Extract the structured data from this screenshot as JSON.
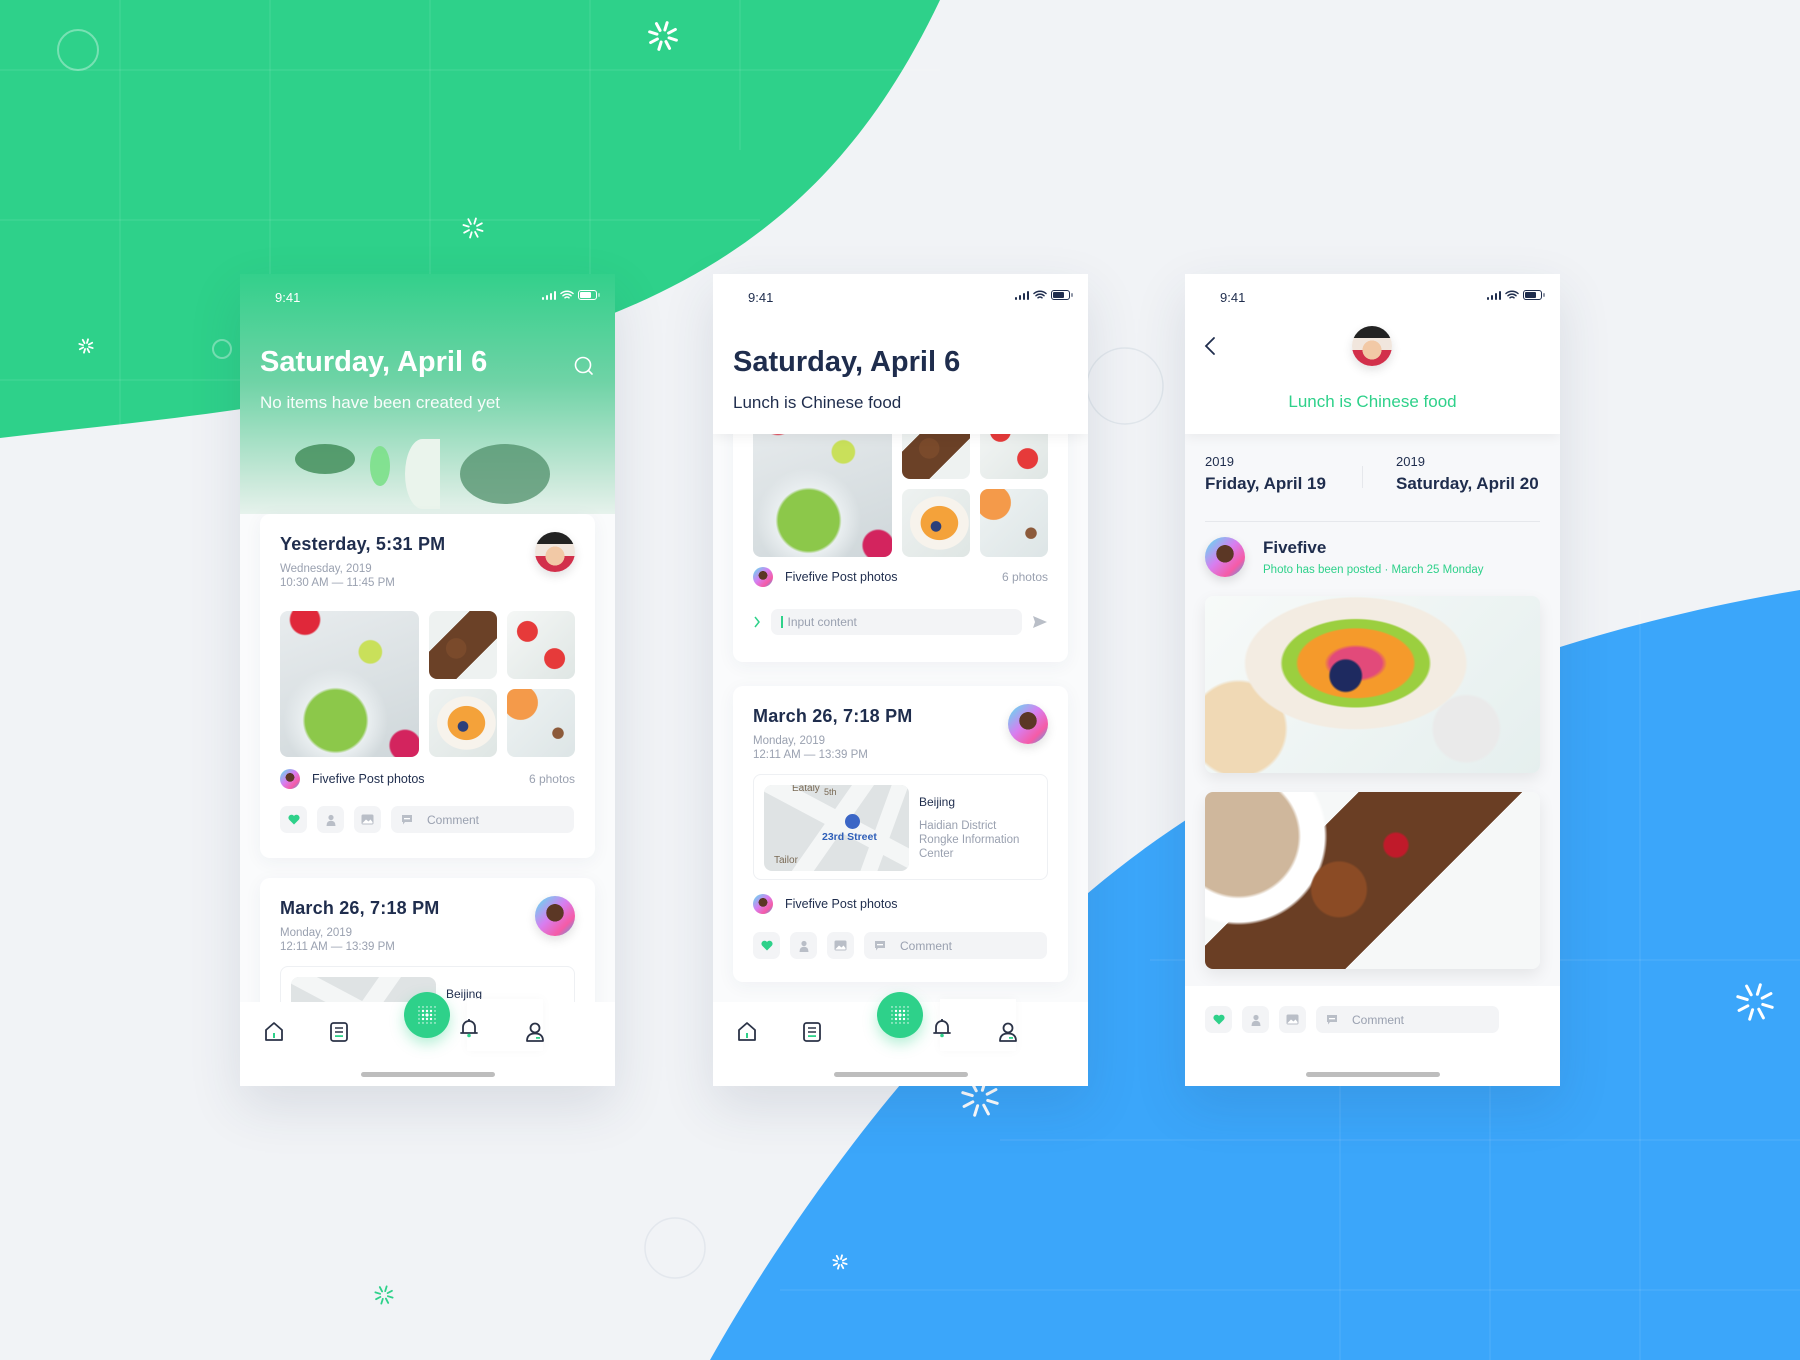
{
  "colors": {
    "brand_green": "#2ed18a",
    "accent_blue": "#3ba6fa",
    "background": "#f1f3f6",
    "text_dark": "#1f2d4d",
    "text_muted": "#9aa1b0"
  },
  "status_bar": {
    "time": "9:41",
    "icons": [
      "signal-icon",
      "wifi-icon",
      "battery-icon"
    ]
  },
  "screen_timeline": {
    "title": "Saturday, April 6",
    "subtitle": "No items have been created yet",
    "search_icon": "search-icon",
    "cards": [
      {
        "title": "Yesterday,  5:31 PM",
        "day": "Wednesday, 2019",
        "time_range": "10:30 AM — 11:45 PM",
        "poster": "Fivefive Post photos",
        "photo_count": "6 photos",
        "comment_placeholder": "Comment"
      },
      {
        "title": "March 26,  7:18 PM",
        "day": "Monday, 2019",
        "time_range": "12:11 AM — 13:39 PM",
        "location": "Beijing"
      }
    ]
  },
  "screen_detail": {
    "title": "Saturday, April 6",
    "subtitle": "Lunch is Chinese food",
    "card1": {
      "poster": "Fivefive Post photos",
      "photo_count": "6 photos",
      "input_placeholder": "Input content"
    },
    "card2": {
      "title": "March 26,  7:18 PM",
      "day": "Monday, 2019",
      "time_range": "12:11 AM — 13:39 PM",
      "map": {
        "label_1": "Eataly",
        "label_2": "5th",
        "street": "23rd Street",
        "label_3": "Tailor"
      },
      "location": "Beijing",
      "address_line_1": "Haidian District",
      "address_line_2": "Rongke Information",
      "address_line_3": "Center",
      "poster": "Fivefive Post photos",
      "comment_placeholder": "Comment"
    }
  },
  "screen_post": {
    "title": "Lunch is Chinese food",
    "dates": [
      {
        "year": "2019",
        "date": "Friday, April 19"
      },
      {
        "year": "2019",
        "date": "Saturday, April 20"
      }
    ],
    "author": {
      "name": "Fivefive",
      "subtitle": "Photo has been posted · March 25 Monday"
    },
    "comment_placeholder": "Comment"
  },
  "tabbar": {
    "items": [
      "home-icon",
      "list-icon",
      "grid-fab-icon",
      "bell-icon",
      "profile-icon"
    ]
  }
}
